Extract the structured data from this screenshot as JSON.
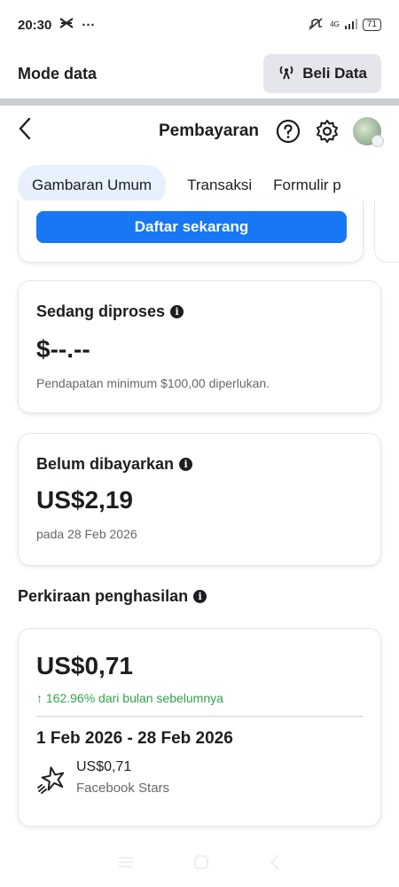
{
  "status_bar": {
    "time": "20:30",
    "network": "4G",
    "battery": "71"
  },
  "data_mode": {
    "title": "Mode data",
    "buy_button": "Beli Data"
  },
  "header": {
    "title": "Pembayaran"
  },
  "tabs": [
    {
      "label": "Gambaran Umum",
      "active": true
    },
    {
      "label": "Transaksi"
    },
    {
      "label": "Formulir p"
    }
  ],
  "signup_card": {
    "button": "Daftar sekarang"
  },
  "processing": {
    "title": "Sedang diproses",
    "amount": "$--.--",
    "note": "Pendapatan minimum $100,00 diperlukan."
  },
  "unpaid": {
    "title": "Belum dibayarkan",
    "amount": "US$2,19",
    "date": "pada 28 Feb 2026"
  },
  "estimate": {
    "section_title": "Perkiraan penghasilan",
    "amount": "US$0,71",
    "growth": "↑ 162.96% dari bulan sebelumnya",
    "period": "1 Feb 2026 - 28 Feb 2026",
    "item_amount": "US$0,71",
    "item_label": "Facebook Stars"
  },
  "colors": {
    "accent": "#1877f2",
    "positive": "#31a24c",
    "tab_active_bg": "#e7f0fd"
  }
}
